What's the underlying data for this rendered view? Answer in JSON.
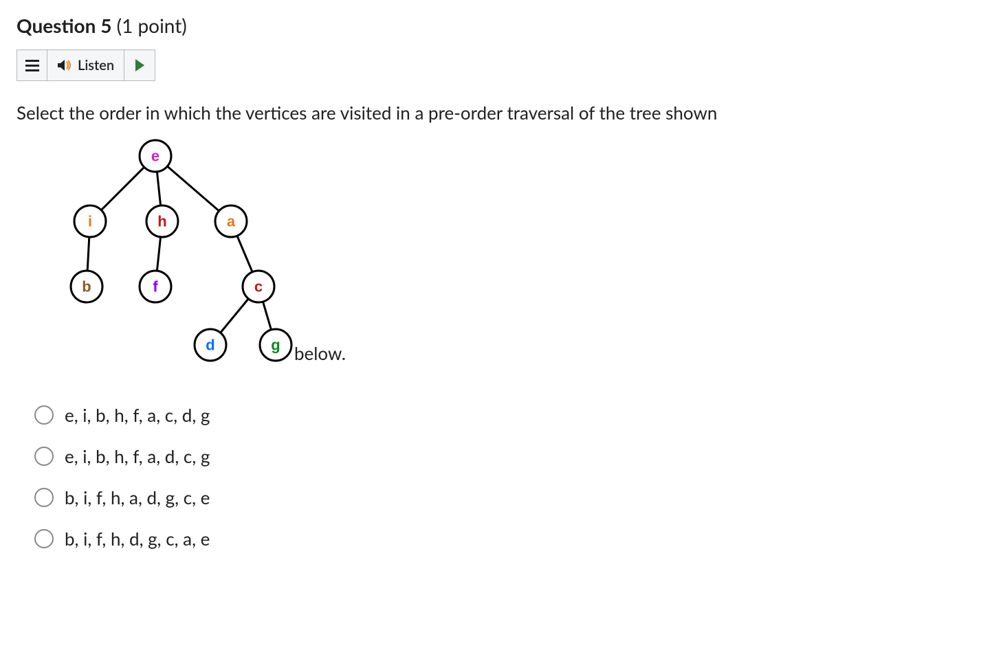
{
  "header": {
    "question_label": "Question 5",
    "points_label": "(1 point)"
  },
  "toolbar": {
    "listen_label": "Listen"
  },
  "question": {
    "text_before": "Select the order in which the vertices are visited in a pre-order traversal of the tree shown",
    "text_after": "below."
  },
  "tree": {
    "nodes": {
      "e": {
        "label": "e",
        "color": "#d21fbd"
      },
      "i": {
        "label": "i",
        "color": "#e07a1f"
      },
      "h": {
        "label": "h",
        "color": "#c11717"
      },
      "a": {
        "label": "a",
        "color": "#e07a1f"
      },
      "b": {
        "label": "b",
        "color": "#8f5a1a"
      },
      "f": {
        "label": "f",
        "color": "#8000ff"
      },
      "c": {
        "label": "c",
        "color": "#c11717"
      },
      "d": {
        "label": "d",
        "color": "#0b6cff"
      },
      "g": {
        "label": "g",
        "color": "#0a8a1f"
      }
    },
    "edges": [
      [
        "e",
        "i"
      ],
      [
        "e",
        "h"
      ],
      [
        "e",
        "a"
      ],
      [
        "i",
        "b"
      ],
      [
        "h",
        "f"
      ],
      [
        "a",
        "c"
      ],
      [
        "c",
        "d"
      ],
      [
        "c",
        "g"
      ]
    ]
  },
  "options": [
    {
      "text": "e, i, b, h, f, a, c, d, g"
    },
    {
      "text": "e, i, b, h, f, a, d, c, g"
    },
    {
      "text": "b, i, f, h, a, d, g, c, e"
    },
    {
      "text": "b, i, f, h, d, g, c, a, e"
    }
  ]
}
